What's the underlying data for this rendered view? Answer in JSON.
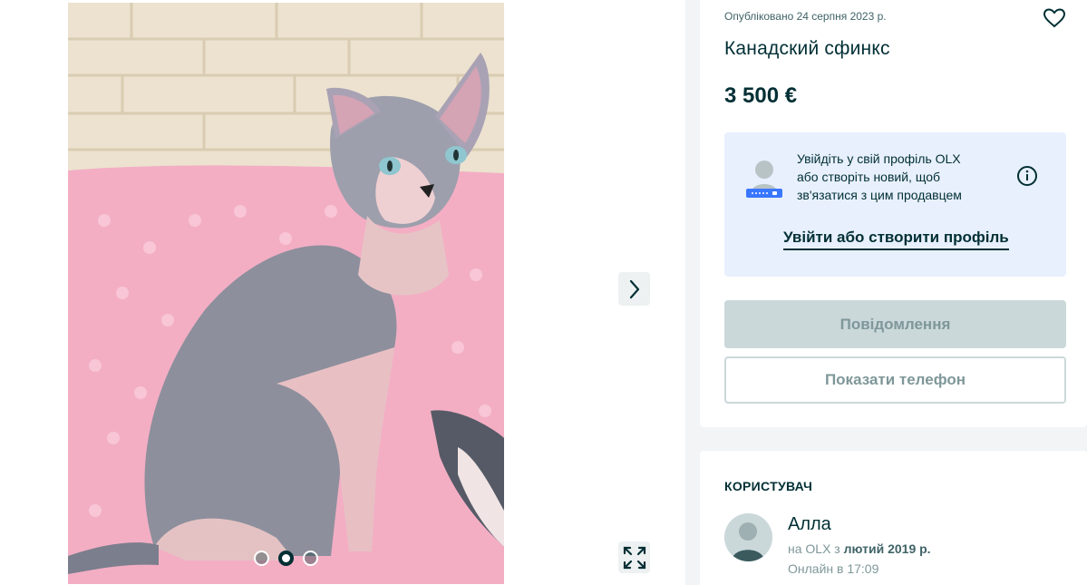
{
  "listing": {
    "published": "Опубліковано 24 серпня 2023 р.",
    "title": "Канадский сфинкс",
    "price": "3 500 €"
  },
  "gallery": {
    "slide_count": 3,
    "active_slide": 2,
    "next_icon": "chevron-right-icon",
    "expand_icon": "expand-icon"
  },
  "login_prompt": {
    "line1": "Увійдіть у свій профіль OLX",
    "line2": "або створіть новий, щоб",
    "line3": "зв'язатися з цим продавцем",
    "link_label": "Увійти або створити профіль"
  },
  "actions": {
    "message_label": "Повідомлення",
    "phone_label": "Показати телефон"
  },
  "seller": {
    "heading": "КОРИСТУВАЧ",
    "name": "Алла",
    "since_prefix": "на OLX з ",
    "since_date": "лютий 2019 р.",
    "online": "Онлайн в 17:09"
  },
  "colors": {
    "primary": "#002f34",
    "login_bg": "#e8f0fe",
    "disabled_bg": "#cbd8da"
  }
}
